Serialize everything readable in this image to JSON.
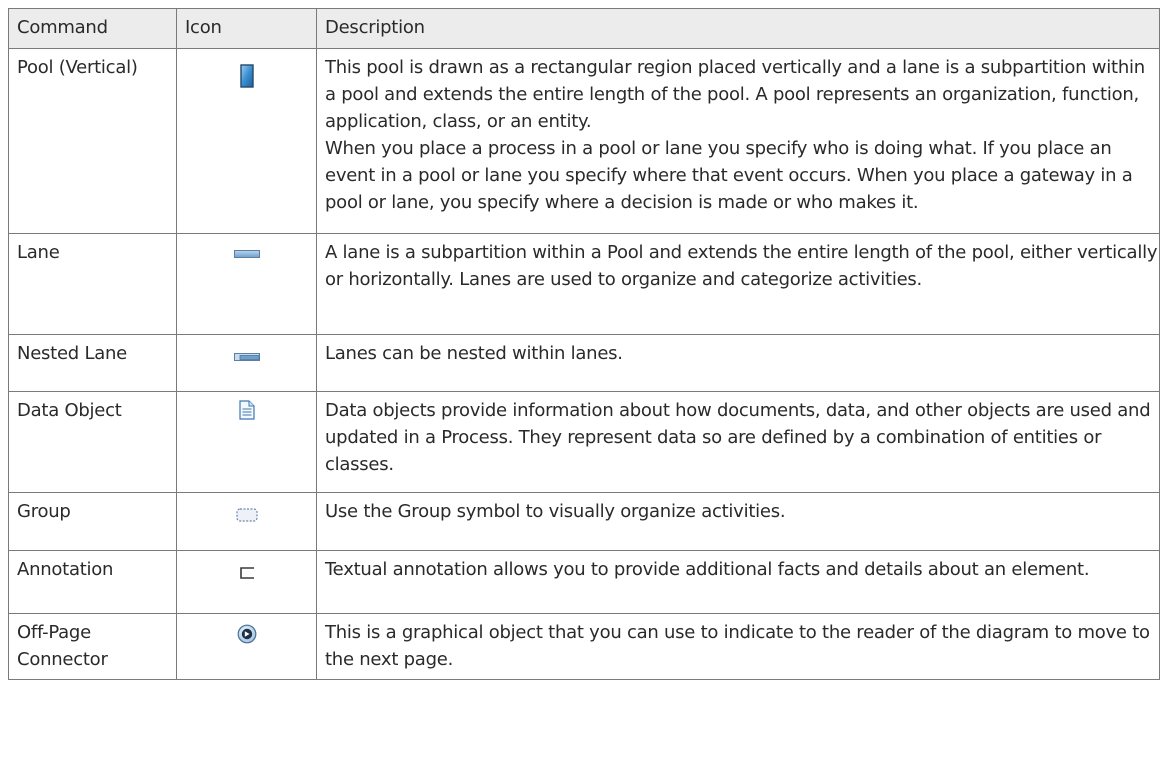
{
  "table": {
    "headers": {
      "command": "Command",
      "icon": "Icon",
      "description": "Description"
    },
    "rows": [
      {
        "command": "Pool (Vertical)",
        "icon": "vertical-pool-icon",
        "description": "This pool is drawn as a rectangular region placed vertically and a lane is a subpartition within a pool and extends the entire length of the pool. A pool represents an organization, function, application, class, or an entity.",
        "description_2": "When you place a process in a pool or lane you specify who is doing what. If you place an event in a pool or lane you specify where that event occurs. When you place a gateway in a pool or lane, you specify where a decision is made or who makes it."
      },
      {
        "command": "Lane",
        "icon": "lane-icon",
        "description": "A lane is a subpartition within a Pool and extends the entire length of the pool, either vertically or horizontally. Lanes are used to organize and categorize activities."
      },
      {
        "command": "Nested Lane",
        "icon": "nested-lane-icon",
        "description": "Lanes can be nested within lanes."
      },
      {
        "command": "Data Object",
        "icon": "data-object-icon",
        "description": "Data objects provide information about how documents, data, and other objects are used and updated in a Process. They represent data so are defined by a combination of entities or classes."
      },
      {
        "command": "Group",
        "icon": "group-icon",
        "description": "Use the Group symbol to visually organize activities."
      },
      {
        "command": "Annotation",
        "icon": "annotation-icon",
        "description": "Textual annotation allows you to provide additional facts and details about an element."
      },
      {
        "command": "Off-Page Connector",
        "icon": "off-page-connector-icon",
        "description": "This is a graphical object that you can use to indicate to the reader of the diagram to move to the next page."
      }
    ]
  },
  "colors": {
    "border": "#7a7a7a",
    "header_bg": "#ececec",
    "text": "#2a2a2a",
    "icon_blue": "#3a7fc2",
    "icon_border": "#2a4f73"
  }
}
